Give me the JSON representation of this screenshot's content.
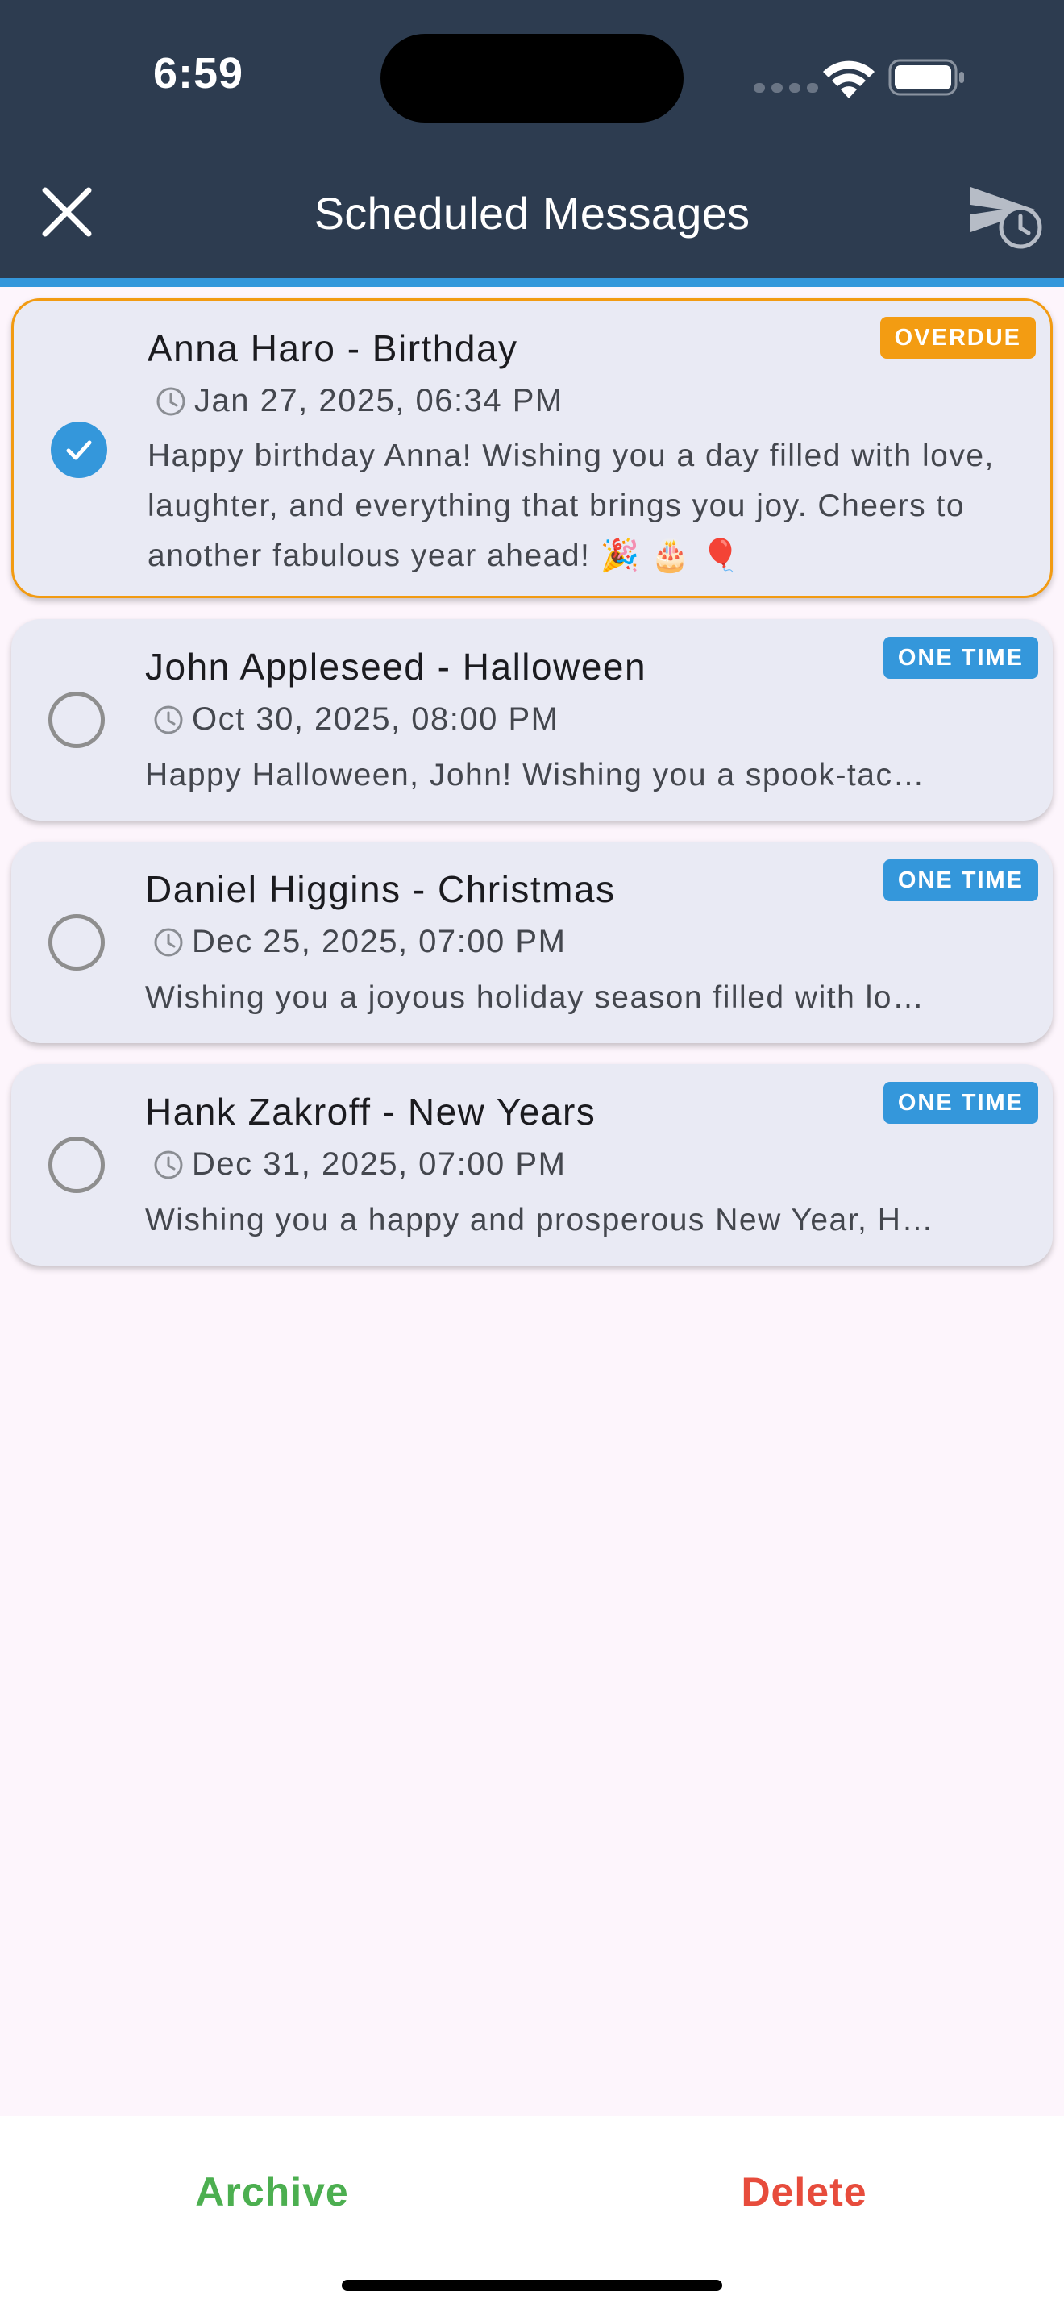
{
  "status_bar": {
    "time": "6:59"
  },
  "header": {
    "title": "Scheduled Messages"
  },
  "colors": {
    "header_bg": "#2d3c50",
    "accent": "#3497db",
    "overdue": "#f39c12",
    "archive": "#4caf50",
    "delete": "#e74c3c"
  },
  "messages": [
    {
      "name": "Anna Haro - Birthday",
      "date": "Jan 27, 2025, 06:34 PM",
      "message": "Happy birthday Anna! Wishing you a day filled with love, laughter, and everything that brings you joy. Cheers to another fabulous year ahead! 🎉 🎂 🎈",
      "badge": "OVERDUE",
      "selected": true
    },
    {
      "name": "John Appleseed - Halloween",
      "date": "Oct 30, 2025, 08:00 PM",
      "message": "Happy Halloween, John! Wishing you a spook-tac…",
      "badge": "ONE TIME",
      "selected": false
    },
    {
      "name": "Daniel Higgins - Christmas",
      "date": "Dec 25, 2025, 07:00 PM",
      "message": "Wishing you a joyous holiday season filled with lo…",
      "badge": "ONE TIME",
      "selected": false
    },
    {
      "name": "Hank Zakroff - New Years",
      "date": "Dec 31, 2025, 07:00 PM",
      "message": "Wishing you a happy and prosperous New Year, H…",
      "badge": "ONE TIME",
      "selected": false
    }
  ],
  "actions": {
    "archive_label": "Archive",
    "delete_label": "Delete"
  }
}
